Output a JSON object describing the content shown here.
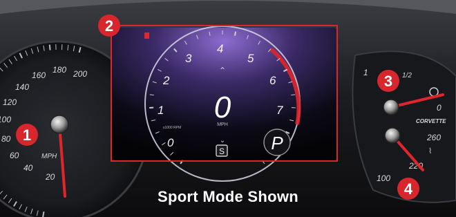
{
  "caption": "Sport Mode Shown",
  "callouts": [
    "1",
    "2",
    "3",
    "4"
  ],
  "speedometer": {
    "ticks": [
      "20",
      "40",
      "60",
      "80",
      "100",
      "120",
      "140",
      "160",
      "180",
      "200"
    ],
    "unit": "MPH"
  },
  "display": {
    "tach_ticks": [
      "0",
      "1",
      "2",
      "3",
      "4",
      "5",
      "6",
      "7"
    ],
    "speed_value": "0",
    "speed_unit": "MPH",
    "rpm_label": "x1000 RPM",
    "gear": "S",
    "park": "P"
  },
  "fuel_gauge": {
    "ticks": [
      "1",
      "1/2",
      "0"
    ]
  },
  "temp_gauge": {
    "brand": "CORVETTE",
    "ticks": [
      "100",
      "220",
      "260"
    ]
  },
  "colors": {
    "needle": "#e0262c",
    "callout": "#d7262c",
    "highlight_box": "#e0262c",
    "screen_glow": "#7a5ab8"
  }
}
